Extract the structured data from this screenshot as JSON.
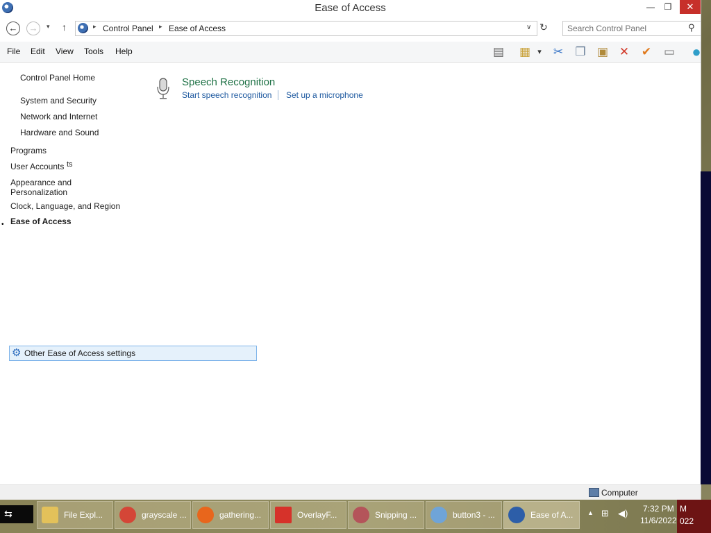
{
  "window": {
    "title": "Ease of Access",
    "minimize_glyph": "—",
    "maximize_glyph": "❐",
    "close_glyph": "✕"
  },
  "address": {
    "back_glyph": "←",
    "forward_glyph": "→",
    "recent_glyph": "▾",
    "up_glyph": "↑",
    "crumb_separator": "▸",
    "breadcrumbs": [
      "Control Panel",
      "Ease of Access"
    ],
    "dropdown_glyph": "∨",
    "refresh_glyph": "↻",
    "search_placeholder": "Search Control Panel",
    "search_glyph": "⚲"
  },
  "menu": {
    "items": [
      "File",
      "Edit",
      "View",
      "Tools",
      "Help"
    ]
  },
  "toolbar": {
    "icons": [
      {
        "name": "layout-pane-icon",
        "glyph": "▤",
        "color": "#666666"
      },
      {
        "name": "properties-icon",
        "glyph": "▦",
        "color": "#c9a23a"
      },
      {
        "name": "dropdown-arrow-icon",
        "glyph": "▾",
        "color": "#333333"
      },
      {
        "name": "cut-icon",
        "glyph": "✂",
        "color": "#3c78c8"
      },
      {
        "name": "copy-icon",
        "glyph": "❐",
        "color": "#6a7f99"
      },
      {
        "name": "paste-icon",
        "glyph": "▣",
        "color": "#b08a3a"
      },
      {
        "name": "delete-icon",
        "glyph": "✕",
        "color": "#d23a2a"
      },
      {
        "name": "check-icon",
        "glyph": "✔",
        "color": "#e07a1e"
      },
      {
        "name": "rename-icon",
        "glyph": "▭",
        "color": "#777777"
      },
      {
        "name": "globe-icon",
        "glyph": "●",
        "color": "#2f9ec9"
      }
    ]
  },
  "sidebar": {
    "home": "Control Panel Home",
    "bullet": "•",
    "items": [
      "System and Security",
      "Network and Internet",
      "Hardware and Sound",
      "Programs",
      "User Accounts",
      "ts",
      "Appearance and",
      "Personalization",
      "Clock, Language, and Region",
      "Ease of Access"
    ]
  },
  "main": {
    "section_title": "Speech Recognition",
    "tasks": [
      "Start speech recognition",
      "Set up a microphone"
    ],
    "other_settings": "Other Ease of Access settings",
    "gear_glyph": "⚙"
  },
  "status": {
    "text": "Computer"
  },
  "taskbar": {
    "start_glyph": "⇆",
    "tasks": [
      {
        "label": "File Expl...",
        "icon": "folder-icon",
        "color": "#e3c15a"
      },
      {
        "label": "grayscale ...",
        "icon": "chrome-icon",
        "color": "#d44637"
      },
      {
        "label": "gathering...",
        "icon": "firefox-icon",
        "color": "#e8661c"
      },
      {
        "label": "OverlayF...",
        "icon": "overlay-app-icon",
        "color": "#d6322a"
      },
      {
        "label": "Snipping ...",
        "icon": "scissors-icon",
        "color": "#b4545a"
      },
      {
        "label": "button3 - ...",
        "icon": "paint-icon",
        "color": "#6fa4d8"
      },
      {
        "label": "Ease of A...",
        "icon": "control-panel-icon",
        "color": "#2d5ea8"
      }
    ],
    "tray_up_glyph": "▲",
    "network_glyph": "⊞",
    "volume_glyph": "◀)",
    "time": "7:32 PM",
    "date": "11/6/2022",
    "overflow_a": "M",
    "overflow_b": "022"
  }
}
